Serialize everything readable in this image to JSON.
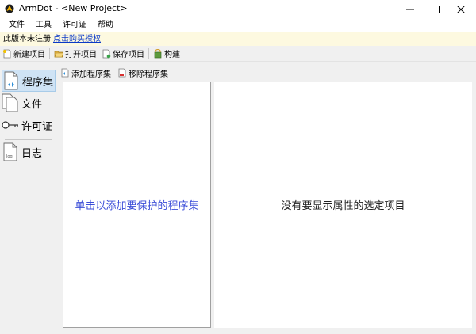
{
  "window": {
    "app_name": "ArmDot",
    "title": "ArmDot - <New Project>"
  },
  "menu": {
    "items": [
      {
        "label": "文件"
      },
      {
        "label": "工具"
      },
      {
        "label": "许可证"
      },
      {
        "label": "帮助"
      }
    ]
  },
  "notice": {
    "text": "此版本未注册",
    "link": "点击购买授权"
  },
  "toolbar": {
    "new_project": "新建项目",
    "open_project": "打开项目",
    "save_project": "保存项目",
    "build": "构建"
  },
  "nav": {
    "items": [
      {
        "label": "程序集",
        "icon": "assembly-icon",
        "active": true
      },
      {
        "label": "文件",
        "icon": "files-icon",
        "active": false
      },
      {
        "label": "许可证",
        "icon": "key-icon",
        "active": false
      },
      {
        "label": "日志",
        "icon": "log-icon",
        "active": false
      }
    ],
    "log_icon_text": "log"
  },
  "subtoolbar": {
    "add_assembly": "添加程序集",
    "remove_assembly": "移除程序集"
  },
  "panels": {
    "left_placeholder": "单击以添加要保护的程序集",
    "right_placeholder": "没有要显示属性的选定项目"
  },
  "colors": {
    "accent_link": "#0a39c7",
    "placeholder_blue": "#3b4dd8",
    "notice_bg": "#fdf9e0",
    "nav_active_bg": "#cfe3f5"
  }
}
